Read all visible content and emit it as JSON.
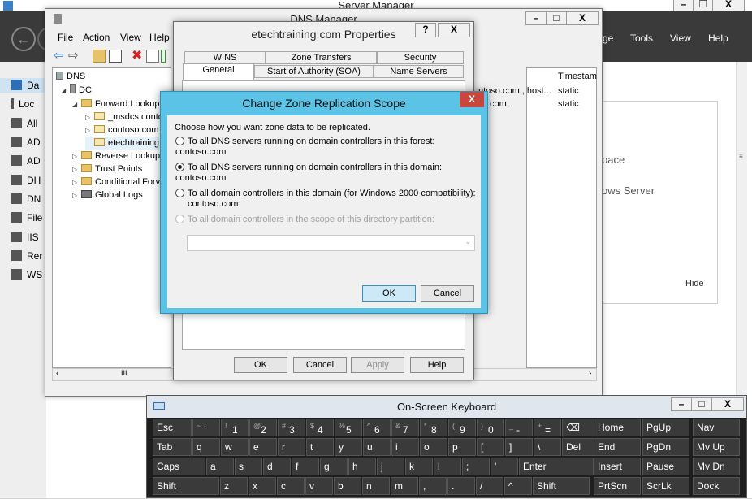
{
  "server_manager": {
    "title": "Server Manager",
    "menu": [
      "ge",
      "Tools",
      "View",
      "Help"
    ],
    "sidebar": [
      "Da",
      "Loc",
      "All",
      "AD",
      "AD",
      "DH",
      "DN",
      "File",
      "IIS",
      "Rer",
      "WS"
    ],
    "bg_text": [
      "pace",
      "ows Server",
      "Hide"
    ]
  },
  "dns_manager": {
    "title": "DNS Manager",
    "menu": [
      "File",
      "Action",
      "View",
      "Help"
    ],
    "tree": [
      {
        "label": "DNS",
        "indent": 0,
        "exp": ""
      },
      {
        "label": "DC",
        "indent": 1,
        "exp": "◢"
      },
      {
        "label": "Forward Lookup",
        "indent": 2,
        "exp": "◢"
      },
      {
        "label": "_msdcs.conto",
        "indent": 3,
        "exp": "▷"
      },
      {
        "label": "contoso.com",
        "indent": 3,
        "exp": "▷"
      },
      {
        "label": "etechtraining",
        "indent": 3,
        "exp": ""
      },
      {
        "label": "Reverse Lookup",
        "indent": 2,
        "exp": "▷"
      },
      {
        "label": "Trust Points",
        "indent": 2,
        "exp": "▷"
      },
      {
        "label": "Conditional Forv",
        "indent": 2,
        "exp": "▷"
      },
      {
        "label": "Global Logs",
        "indent": 2,
        "exp": "▷"
      }
    ],
    "right_header": "Timestam",
    "right_rows": [
      {
        "name": "ntoso.com., host...",
        "ts": "static"
      },
      {
        "name": "com.",
        "ts": "static"
      }
    ],
    "scroll_mid": "III"
  },
  "properties": {
    "title": "etechtraining.com Properties",
    "help_btn": "?",
    "close_btn": "X",
    "tabs_back": [
      "WINS",
      "Zone Transfers",
      "Security"
    ],
    "tabs_front": [
      "General",
      "Start of Authority (SOA)",
      "Name Servers"
    ],
    "buttons": [
      "OK",
      "Cancel",
      "Apply",
      "Help"
    ]
  },
  "czr": {
    "title": "Change Zone Replication Scope",
    "close": "X",
    "prompt": "Choose how you want zone data to be replicated.",
    "options": [
      {
        "text": "To all DNS servers running on domain controllers in this forest: contoso.com",
        "checked": false,
        "disabled": false
      },
      {
        "text": "To all DNS servers running on domain controllers in this domain: contoso.com",
        "checked": true,
        "disabled": false
      },
      {
        "text": "To all domain controllers in this domain (for Windows 2000 compatibility):",
        "line2": "contoso.com",
        "checked": false,
        "disabled": false
      },
      {
        "text": "To all domain controllers in the scope of this directory partition:",
        "checked": false,
        "disabled": true
      }
    ],
    "ok": "OK",
    "cancel": "Cancel"
  },
  "osk": {
    "title": "On-Screen Keyboard",
    "row1": [
      [
        "Esc",
        ""
      ],
      [
        "`",
        "~"
      ],
      [
        "1",
        "!"
      ],
      [
        "2",
        "@"
      ],
      [
        "3",
        "#"
      ],
      [
        "4",
        "$"
      ],
      [
        "5",
        "%"
      ],
      [
        "6",
        "^"
      ],
      [
        "7",
        "&"
      ],
      [
        "8",
        "*"
      ],
      [
        "9",
        "("
      ],
      [
        "0",
        ")"
      ],
      [
        "-",
        "_"
      ],
      [
        "=",
        "+"
      ],
      [
        "⌫",
        ""
      ]
    ],
    "row2": [
      "Tab",
      "q",
      "w",
      "e",
      "r",
      "t",
      "y",
      "u",
      "i",
      "o",
      "p",
      "[",
      "]",
      "\\",
      "Del"
    ],
    "row3": [
      "Caps",
      "a",
      "s",
      "d",
      "f",
      "g",
      "h",
      "j",
      "k",
      "l",
      ";",
      "'",
      "Enter"
    ],
    "row4": [
      "Shift",
      "z",
      "x",
      "c",
      "v",
      "b",
      "n",
      "m",
      ",",
      ".",
      "/",
      "^",
      "Shift"
    ],
    "right": [
      [
        "Home",
        "PgUp",
        "Nav"
      ],
      [
        "End",
        "PgDn",
        "Mv Up"
      ],
      [
        "Insert",
        "Pause",
        "Mv Dn"
      ],
      [
        "PrtScn",
        "ScrLk",
        "Dock"
      ]
    ]
  },
  "colors": {
    "dialog_accent": "#5ac3e6",
    "close_red": "#c9463d",
    "ok_highlight": "#cde8f6"
  }
}
